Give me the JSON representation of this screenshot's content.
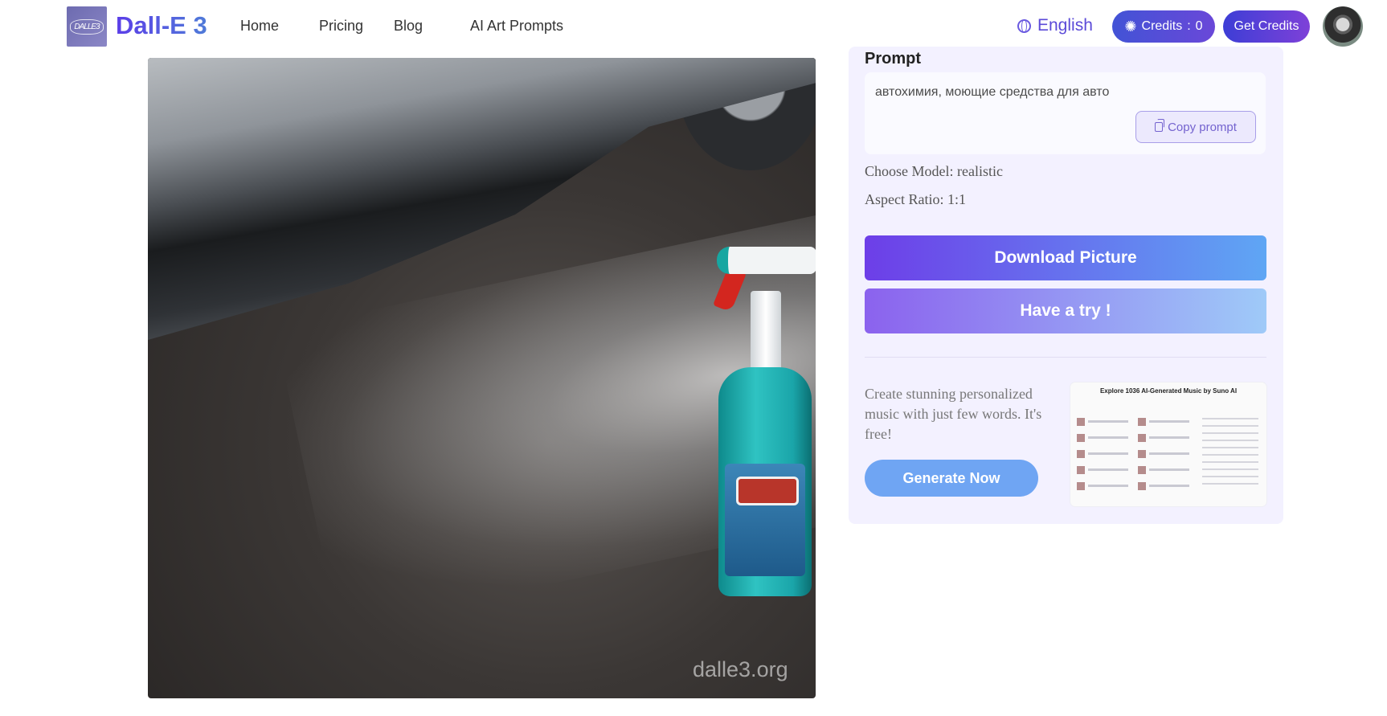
{
  "header": {
    "logo_text": "DALLE3",
    "brand": "Dall-E 3",
    "nav": [
      "Home",
      "Pricing",
      "Blog",
      "AI Art Prompts"
    ],
    "language": "English",
    "credits_label": "Credits",
    "credits_sep": ":",
    "credits_value": "0",
    "get_credits": "Get Credits"
  },
  "picture": {
    "watermark": "dalle3.org"
  },
  "panel": {
    "prompt_title": "Prompt",
    "prompt_text": "автохимия, моющие средства для авто",
    "copy_prompt": "Copy prompt",
    "model_label": "Choose Model:",
    "model_value": "realistic",
    "aspect_label": "Aspect Ratio:",
    "aspect_value": "1:1",
    "download_button": "Download Picture",
    "try_button": "Have a try !",
    "promo_text": "Create stunning personalized music with just few words. It's free!",
    "generate_button": "Generate Now",
    "promo_thumb_title": "Explore 1036 AI-Generated Music by Suno AI"
  },
  "colors": {
    "accent_purple": "#6d3ee8",
    "accent_blue": "#5fa6f4",
    "panel_bg": "#f3f1ff"
  }
}
